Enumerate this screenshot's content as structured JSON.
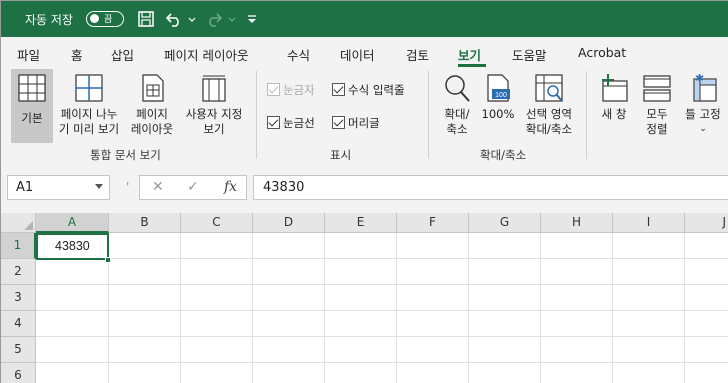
{
  "titlebar": {
    "autosave_label": "자동 저장",
    "autosave_state": "끔",
    "bg_color": "#1e7145"
  },
  "tabs": [
    {
      "label": "파일"
    },
    {
      "label": "홈"
    },
    {
      "label": "삽입"
    },
    {
      "label": "페이지 레이아웃"
    },
    {
      "label": "수식"
    },
    {
      "label": "데이터"
    },
    {
      "label": "검토"
    },
    {
      "label": "보기"
    },
    {
      "label": "도움말"
    },
    {
      "label": "Acrobat"
    }
  ],
  "ribbon": {
    "views": {
      "normal": "기본",
      "page_break_line1": "페이지 나누",
      "page_break_line2": "기 미리 보기",
      "page_layout_line1": "페이지",
      "page_layout_line2": "레이아웃",
      "custom_line1": "사용자 지정",
      "custom_line2": "보기",
      "group_label": "통합 문서 보기"
    },
    "show": {
      "ruler": "눈금자",
      "formula_bar": "수식 입력줄",
      "gridlines": "눈금선",
      "headings": "머리글",
      "group_label": "표시"
    },
    "zoom": {
      "zoom_line1": "확대/",
      "zoom_line2": "축소",
      "hundred": "100%",
      "selection_line1": "선택 영역",
      "selection_line2": "확대/축소",
      "group_label": "확대/축소"
    },
    "window": {
      "new_window": "새 창",
      "arrange_line1": "모두",
      "arrange_line2": "정렬",
      "freeze": "틀 고정"
    }
  },
  "formula_bar": {
    "name_box": "A1",
    "fx": "fx",
    "value": "43830"
  },
  "grid": {
    "columns": [
      "A",
      "B",
      "C",
      "D",
      "E",
      "F",
      "G",
      "H",
      "I",
      "J"
    ],
    "rows": [
      "1",
      "2",
      "3",
      "4",
      "5",
      "6"
    ],
    "cell_a1": "43830"
  },
  "colors": {
    "accent": "#1e7145",
    "ribbon_bg": "#f3f3f3",
    "header_bg": "#e6e6e6"
  }
}
